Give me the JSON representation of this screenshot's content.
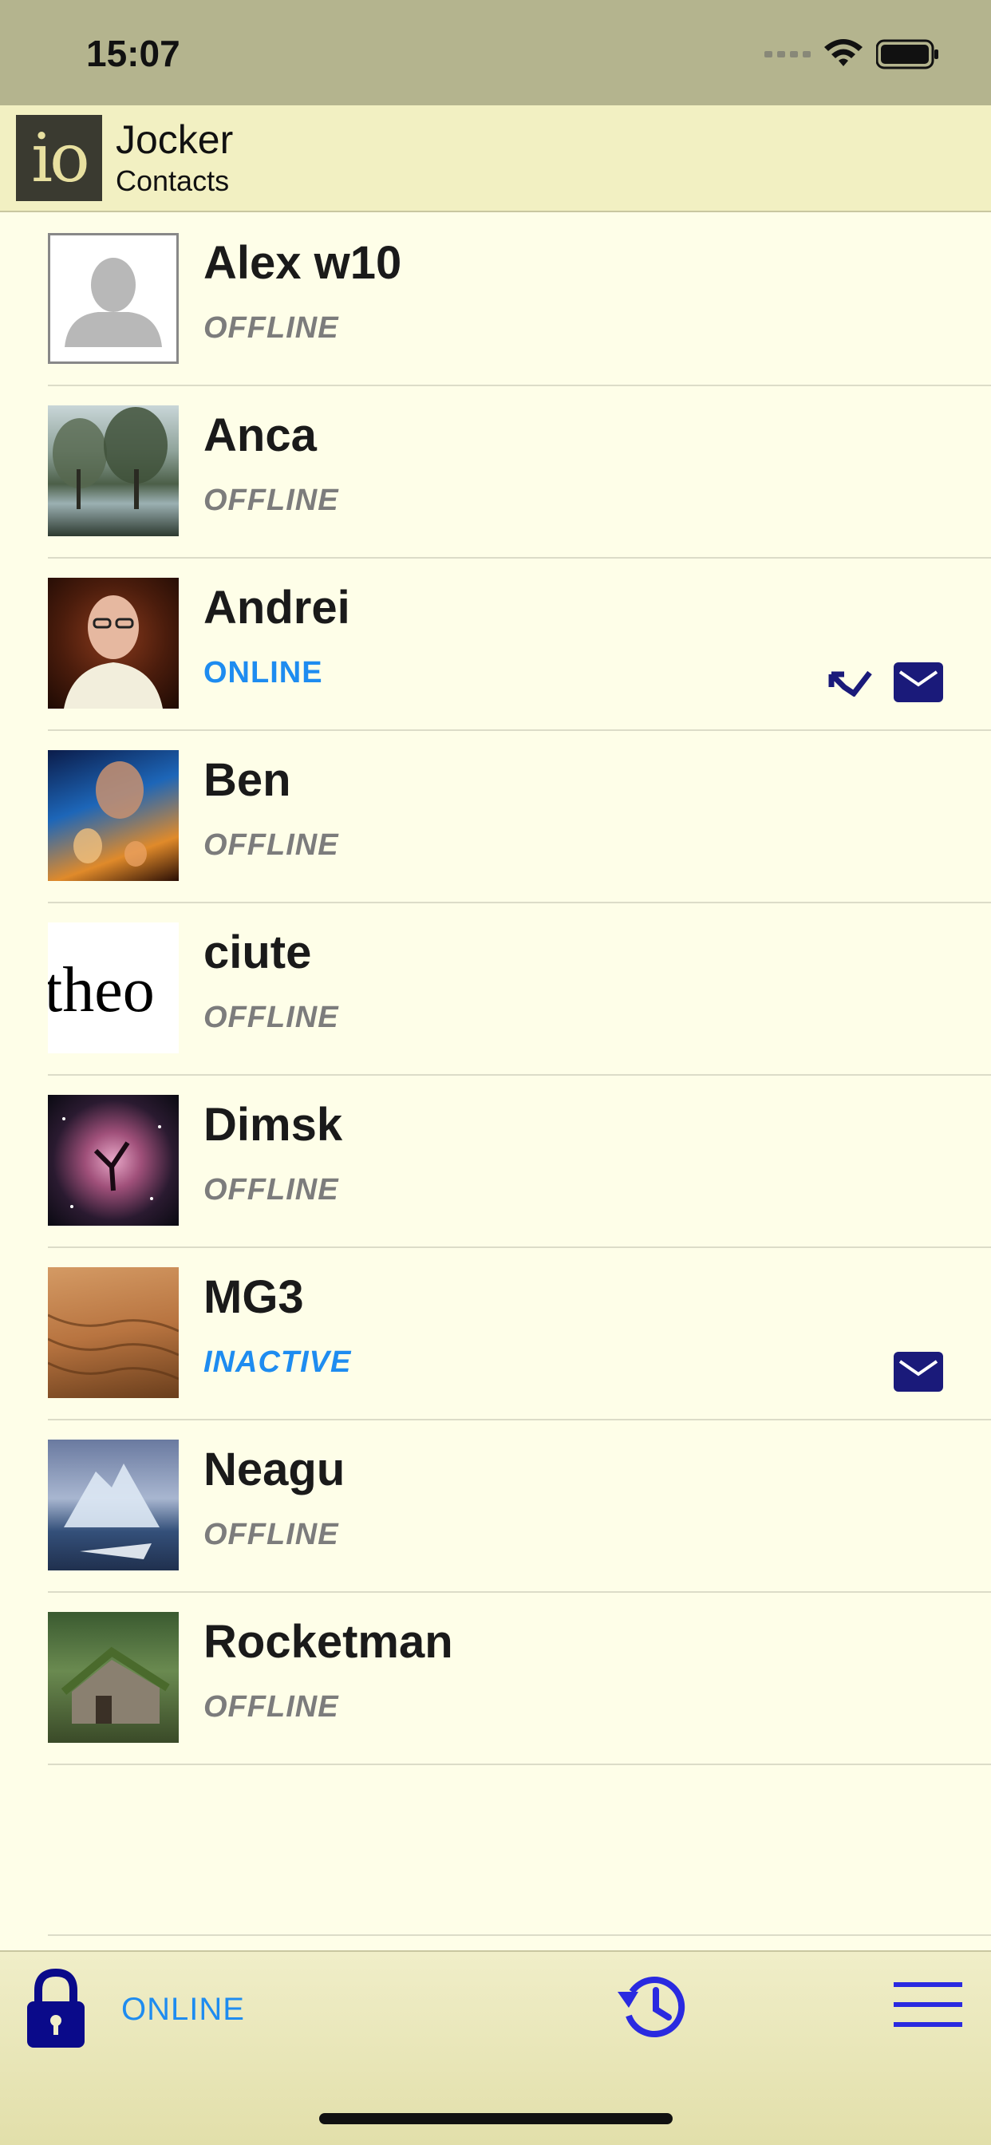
{
  "status_bar": {
    "time": "15:07"
  },
  "header": {
    "logo_text": "io",
    "title": "Jocker",
    "subtitle": "Contacts"
  },
  "contacts": [
    {
      "name": "Alex w10",
      "status": "OFFLINE",
      "avatar": "default-person-icon"
    },
    {
      "name": "Anca",
      "status": "OFFLINE",
      "avatar": "trees-photo"
    },
    {
      "name": "Andrei",
      "status": "ONLINE",
      "avatar": "man-photo",
      "icons": [
        "missed-call-icon",
        "mail-icon"
      ]
    },
    {
      "name": "Ben",
      "status": "OFFLINE",
      "avatar": "movie-poster-photo"
    },
    {
      "name": "ciute",
      "status": "OFFLINE",
      "avatar": "text-image",
      "avatar_text": "theo"
    },
    {
      "name": "Dimsk",
      "status": "OFFLINE",
      "avatar": "nebula-photo"
    },
    {
      "name": "MG3",
      "status": "INACTIVE",
      "avatar": "desert-photo",
      "icons": [
        "mail-icon"
      ]
    },
    {
      "name": "Neagu",
      "status": "OFFLINE",
      "avatar": "iceberg-photo"
    },
    {
      "name": "Rocketman",
      "status": "OFFLINE",
      "avatar": "cabin-photo"
    }
  ],
  "bottom_bar": {
    "status": "ONLINE",
    "icons": [
      "lock-icon",
      "history-icon",
      "menu-icon"
    ]
  },
  "colors": {
    "status_bar_bg": "#b4b48e",
    "header_bg": "#f2f0c2",
    "page_bg": "#fefee8",
    "accent_blue": "#1e8cf0",
    "icon_navy": "#1a1a7a",
    "offline_gray": "#7c7c7c"
  }
}
